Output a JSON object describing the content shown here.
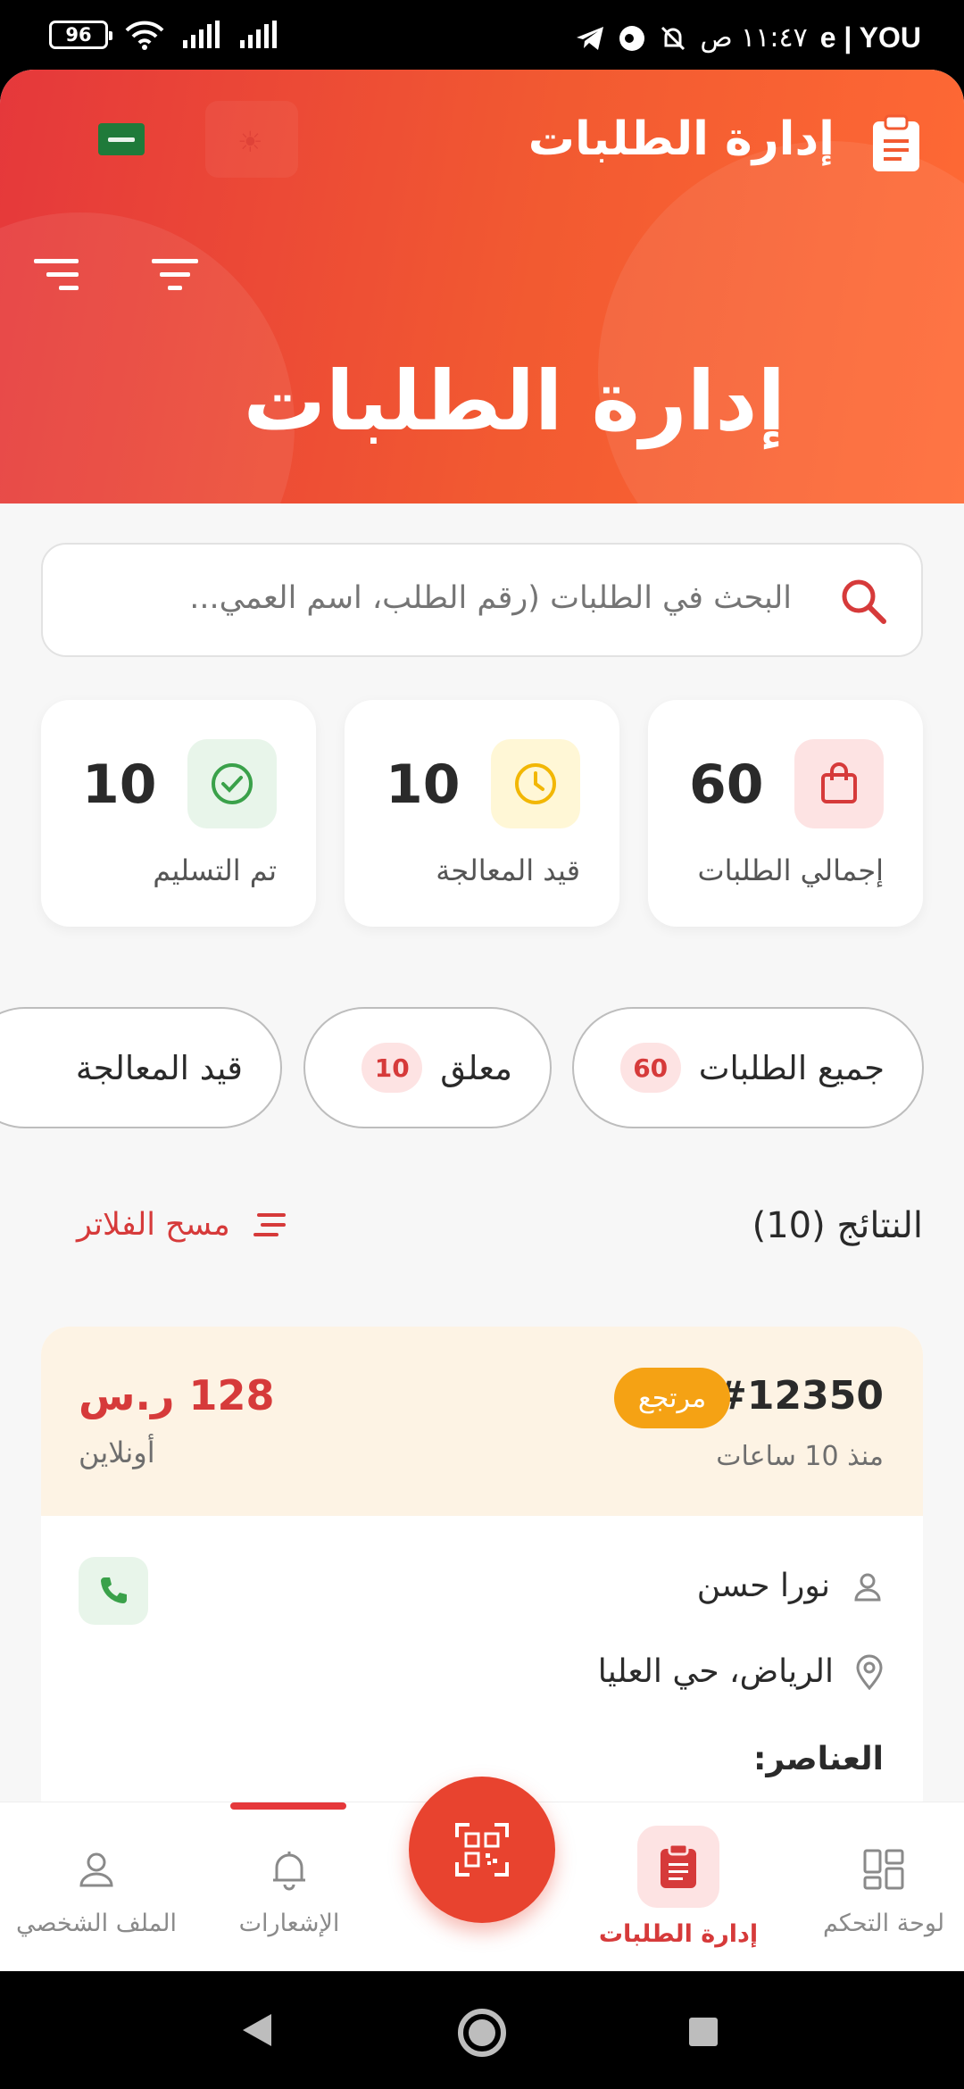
{
  "status_bar": {
    "battery": "96",
    "time": "١١:٤٧ ص",
    "carrier": "e | YOU"
  },
  "header": {
    "title": "إدارة الطلبات",
    "hero_title": "إدارة الطلبات",
    "icons": [
      "clipboard-icon",
      "saudi-flag-icon",
      "sun-icon",
      "filter-icon",
      "sort-icon"
    ]
  },
  "search": {
    "placeholder": "البحث في الطلبات (رقم الطلب، اسم العمي..."
  },
  "stats": [
    {
      "label": "إجمالي الطلبات",
      "value": "60",
      "icon": "shopping-bag-icon",
      "color": "#d63a3a"
    },
    {
      "label": "قيد المعالجة",
      "value": "10",
      "icon": "clock-icon",
      "color": "#f2b705"
    },
    {
      "label": "تم التسليم",
      "value": "10",
      "icon": "check-circle-icon",
      "color": "#3aa14a"
    }
  ],
  "tabs": [
    {
      "label": "جميع الطلبات",
      "count": "60"
    },
    {
      "label": "معلق",
      "count": "10"
    },
    {
      "label": "قيد المعالجة",
      "count": ""
    }
  ],
  "results": {
    "label": "النتائج (10)",
    "clear_filters": "مسح الفلاتر"
  },
  "order": {
    "id": "#12350",
    "status": "مرتجع",
    "time_ago": "منذ 10 ساعات",
    "price": "128 ر.س",
    "payment": "أونلاين",
    "customer": "نورا حسن",
    "location": "الرياض، حي العليا",
    "items_label": "العناصر:"
  },
  "bottom_nav": [
    {
      "label": "لوحة التحكم",
      "icon": "dashboard-icon"
    },
    {
      "label": "إدارة الطلبات",
      "icon": "clipboard-icon",
      "active": true
    },
    {
      "label": "qr-scan",
      "icon": "qr-scan-icon"
    },
    {
      "label": "الإشعارات",
      "icon": "bell-icon"
    },
    {
      "label": "الملف الشخصي",
      "icon": "user-icon"
    }
  ],
  "colors": {
    "accent": "#e5383b",
    "accent_orange": "#ff6a35",
    "status_returned": "#f5a214"
  }
}
